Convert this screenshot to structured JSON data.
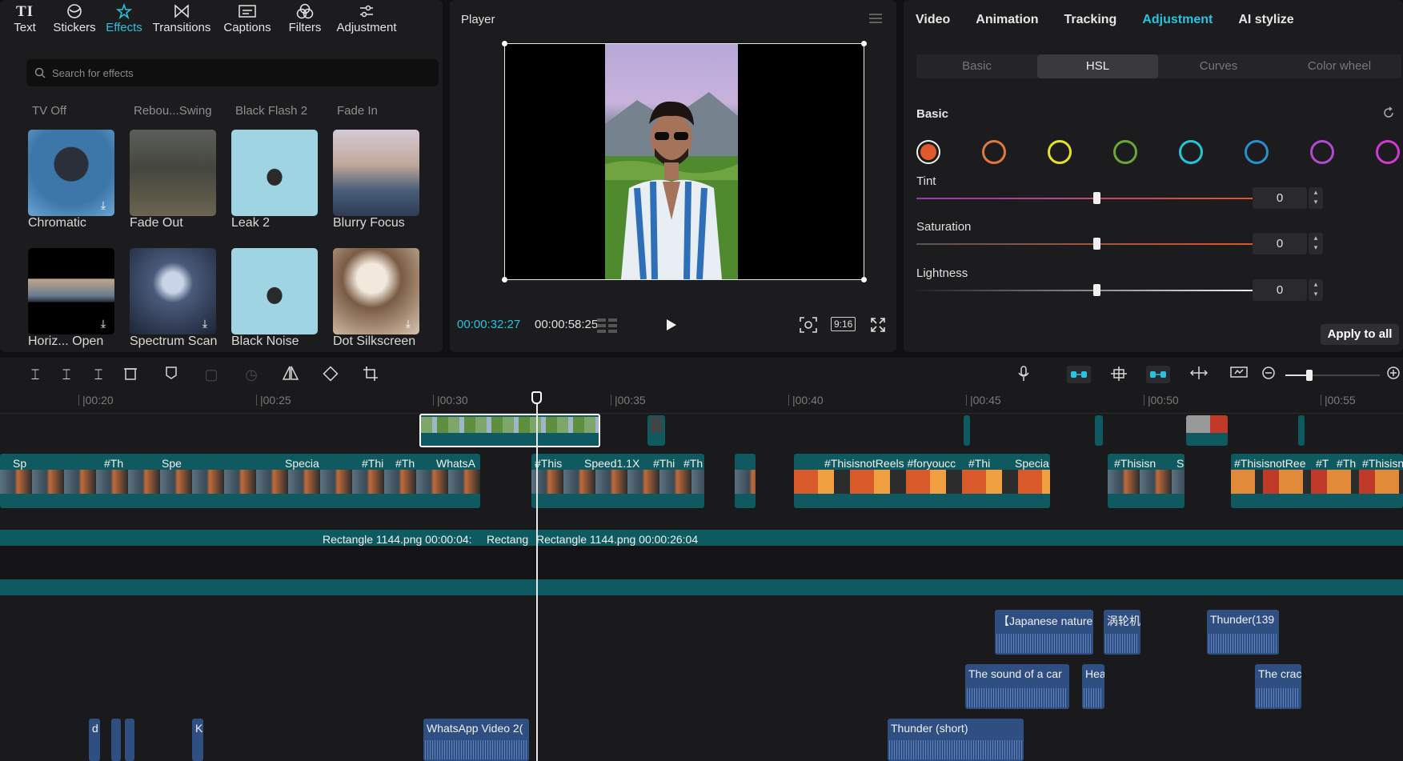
{
  "tool_tabs": [
    {
      "label": "Text",
      "icon": "text-icon"
    },
    {
      "label": "Stickers",
      "icon": "sticker-icon"
    },
    {
      "label": "Effects",
      "icon": "effects-icon"
    },
    {
      "label": "Transitions",
      "icon": "transitions-icon"
    },
    {
      "label": "Captions",
      "icon": "captions-icon"
    },
    {
      "label": "Filters",
      "icon": "filters-icon"
    },
    {
      "label": "Adjustment",
      "icon": "adjustment-icon"
    }
  ],
  "search": {
    "placeholder": "Search for effects"
  },
  "effect_headers": [
    "TV Off",
    "Rebou...Swing",
    "Black Flash 2",
    "Fade In"
  ],
  "effects": [
    {
      "label": "Chromatic",
      "download": true
    },
    {
      "label": "Fade Out",
      "download": false
    },
    {
      "label": "Leak 2",
      "download": false
    },
    {
      "label": "Blurry Focus",
      "download": false
    },
    {
      "label": "Horiz... Open",
      "download": true
    },
    {
      "label": "Spectrum Scan",
      "download": true
    },
    {
      "label": "Black Noise",
      "download": false
    },
    {
      "label": "Dot Silkscreen",
      "download": true
    }
  ],
  "player": {
    "title": "Player",
    "current_time": "00:00:32:27",
    "total_time": "00:00:58:25",
    "ratio": "9:16"
  },
  "right_tabs": [
    "Video",
    "Animation",
    "Tracking",
    "Adjustment",
    "AI stylize"
  ],
  "sub_tabs": [
    "Basic",
    "HSL",
    "Curves",
    "Color wheel"
  ],
  "adjust": {
    "section": "Basic",
    "colors": [
      "#e0582c",
      "#e07a3a",
      "#e6e22a",
      "#6aa63a",
      "#29c3d8",
      "#2a8fd0",
      "#b04ad0",
      "#d03ad0"
    ],
    "sliders": [
      {
        "name": "Tint",
        "value": "0"
      },
      {
        "name": "Saturation",
        "value": "0"
      },
      {
        "name": "Lightness",
        "value": "0"
      }
    ],
    "apply_all": "Apply to all"
  },
  "ruler": [
    "|00:20",
    "|00:25",
    "|00:30",
    "|00:35",
    "|00:40",
    "|00:45",
    "|00:50",
    "|00:55"
  ],
  "text_clips": [
    {
      "label": "Rectangle 1144.png  00:00:04:"
    },
    {
      "label": "Rectang"
    },
    {
      "label": "Rectangle 1144.png  00:00:26:04"
    }
  ],
  "effect_clips": [
    "Sp",
    "#Th",
    "Spe",
    "Specia",
    "#Thi",
    "#Th",
    "WhatsA",
    "#This",
    "Speed1.1X",
    "#Thi",
    "#Th",
    "#ThisisnotReels #foryoucc",
    "#Thi",
    "Specia",
    "#Thisisn",
    "S",
    "#ThisisnotRee",
    "#T",
    "#Th",
    "#Thisisn"
  ],
  "audio_clips": [
    {
      "label": "【Japanese nature"
    },
    {
      "label": "涡轮机"
    },
    {
      "label": "Thunder(139"
    },
    {
      "label": "The sound of a car"
    },
    {
      "label": "Hea"
    },
    {
      "label": "The crac"
    },
    {
      "label": "d"
    },
    {
      "label": "K"
    },
    {
      "label": "WhatsApp Video 2("
    },
    {
      "label": "Thunder (short)"
    }
  ]
}
